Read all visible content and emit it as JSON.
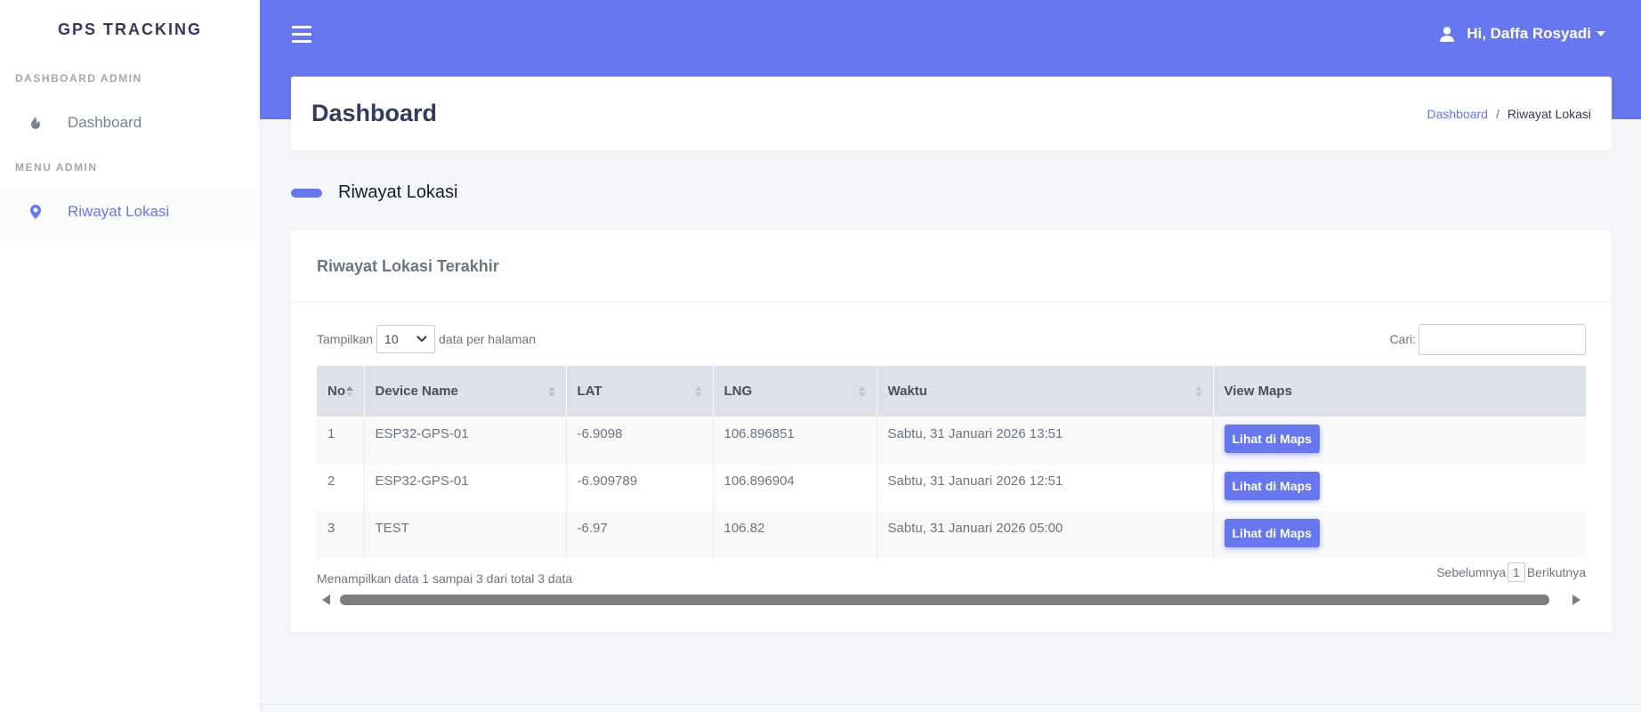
{
  "sidebar": {
    "brand": "GPS TRACKING",
    "sections": [
      {
        "header": "DASHBOARD ADMIN",
        "items": [
          {
            "label": "Dashboard",
            "icon": "fire-icon"
          }
        ]
      },
      {
        "header": "MENU ADMIN",
        "items": [
          {
            "label": "Riwayat Lokasi",
            "icon": "map-marker-icon"
          }
        ]
      }
    ]
  },
  "topbar": {
    "user_greeting": "Hi, Daffa Rosyadi",
    "accent": "#6777ef"
  },
  "header": {
    "title": "Dashboard",
    "breadcrumb": {
      "link": "Dashboard",
      "separator": "/",
      "current": "Riwayat Lokasi"
    }
  },
  "section_title": "Riwayat Lokasi",
  "card": {
    "title": "Riwayat Lokasi Terakhir",
    "length_prefix": "Tampilkan",
    "length_value": "10",
    "length_suffix": "data per halaman",
    "search_label": "Cari:",
    "search_value": "",
    "columns": [
      "No",
      "Device Name",
      "LAT",
      "LNG",
      "Waktu",
      "View Maps"
    ],
    "rows": [
      {
        "no": "1",
        "device": "ESP32-GPS-01",
        "lat": "-6.9098",
        "lng": "106.896851",
        "waktu": "Sabtu, 31 Januari 2026 13:51",
        "action": "Lihat di Maps"
      },
      {
        "no": "2",
        "device": "ESP32-GPS-01",
        "lat": "-6.909789",
        "lng": "106.896904",
        "waktu": "Sabtu, 31 Januari 2026 12:51",
        "action": "Lihat di Maps"
      },
      {
        "no": "3",
        "device": "TEST",
        "lat": "-6.97",
        "lng": "106.82",
        "waktu": "Sabtu, 31 Januari 2026 05:00",
        "action": "Lihat di Maps"
      }
    ],
    "info": "Menampilkan data 1 sampai 3 dari total 3 data",
    "pagination": {
      "prev": "Sebelumnya",
      "page": "1",
      "next": "Berikutnya"
    }
  }
}
